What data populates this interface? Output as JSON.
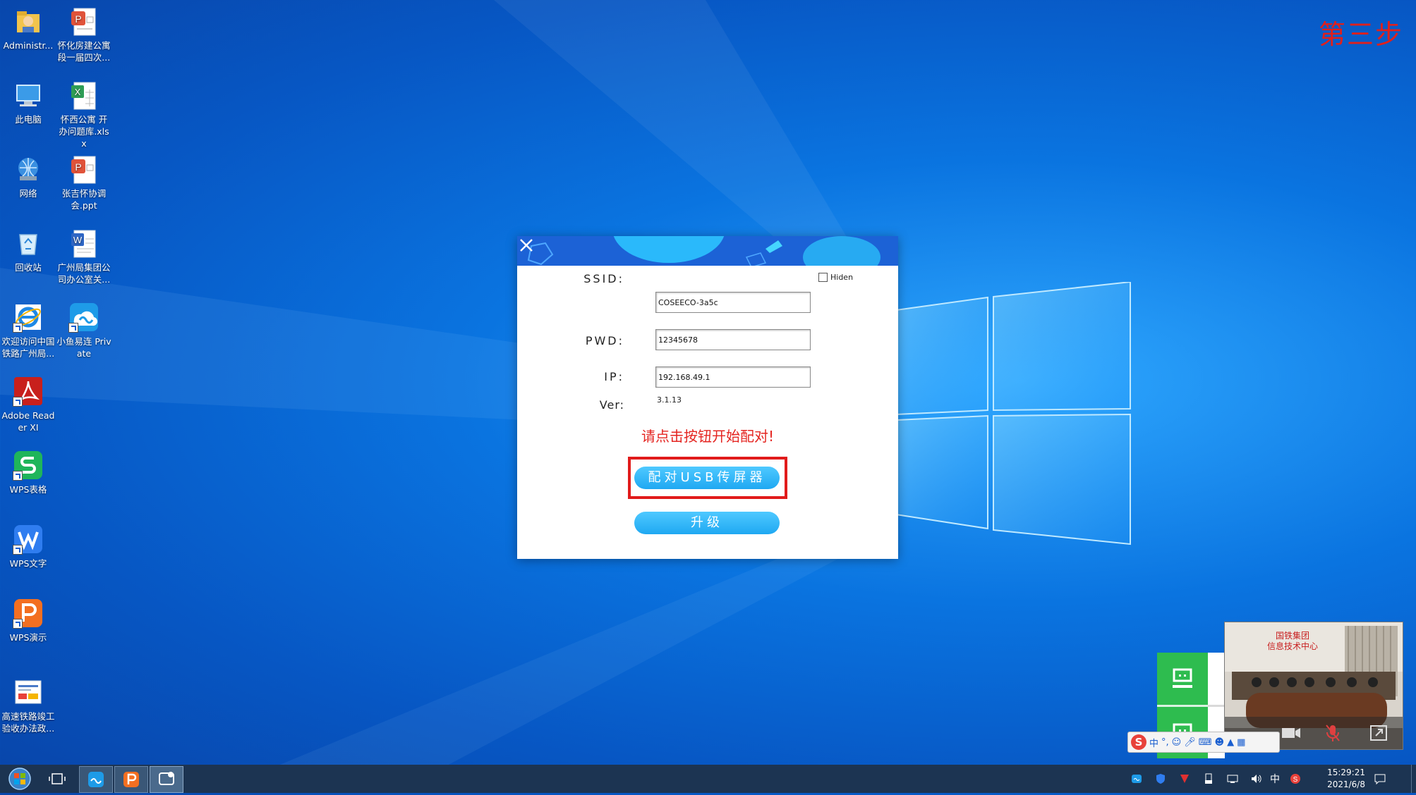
{
  "step_label": "第三步",
  "desktop": {
    "icons_col1": [
      {
        "name": "administrator-icon",
        "label": "Administr..."
      },
      {
        "name": "this-pc-icon",
        "label": "此电脑"
      },
      {
        "name": "network-icon",
        "label": "网络"
      },
      {
        "name": "recycle-bin-icon",
        "label": "回收站"
      },
      {
        "name": "ie-icon",
        "label": "欢迎访问中国铁路广州局..."
      },
      {
        "name": "adobe-reader-icon",
        "label": "Adobe Reader XI"
      },
      {
        "name": "wps-spreadsheet-icon",
        "label": "WPS表格"
      },
      {
        "name": "wps-writer-icon",
        "label": "WPS文字"
      },
      {
        "name": "wps-presentation-icon",
        "label": "WPS演示"
      },
      {
        "name": "railway-doc-icon",
        "label": "高速铁路竣工验收办法政..."
      }
    ],
    "icons_col2": [
      {
        "name": "ppt-file-icon",
        "label": "怀化房建公寓段一届四次..."
      },
      {
        "name": "xlsx-file-icon",
        "label": "怀西公寓 开办问题库.xlsx"
      },
      {
        "name": "ppt-file-icon-2",
        "label": "张吉怀协调会.ppt"
      },
      {
        "name": "word-file-icon",
        "label": "广州局集团公司办公室关..."
      },
      {
        "name": "xiaoyu-icon",
        "label": "小鱼易连 Private"
      }
    ]
  },
  "dialog": {
    "ssid_label": "SSID:",
    "ssid_value": "COSEECO-3a5c",
    "hidden_label": "Hiden",
    "pwd_label": "PWD:",
    "pwd_value": "12345678",
    "ip_label": "IP:",
    "ip_value": "192.168.49.1",
    "ver_label": "Ver:",
    "ver_value": "3.1.13",
    "prompt": "请点击按钮开始配对!",
    "pair_button": "配对USB传屏器",
    "upgrade_button": "升级"
  },
  "video": {
    "sign_line1": "国铁集团",
    "sign_line2": "信息技术中心"
  },
  "ime": {
    "logo": "S",
    "mode": "中"
  },
  "taskbar": {
    "time": "15:29:21",
    "date": "2021/6/8",
    "ime_lang": "中"
  },
  "colors": {
    "accent_blue": "#1fa8f2",
    "highlight_red": "#e11b1b",
    "prompt_red": "#e42420",
    "green_panel": "#2ebc4f"
  }
}
